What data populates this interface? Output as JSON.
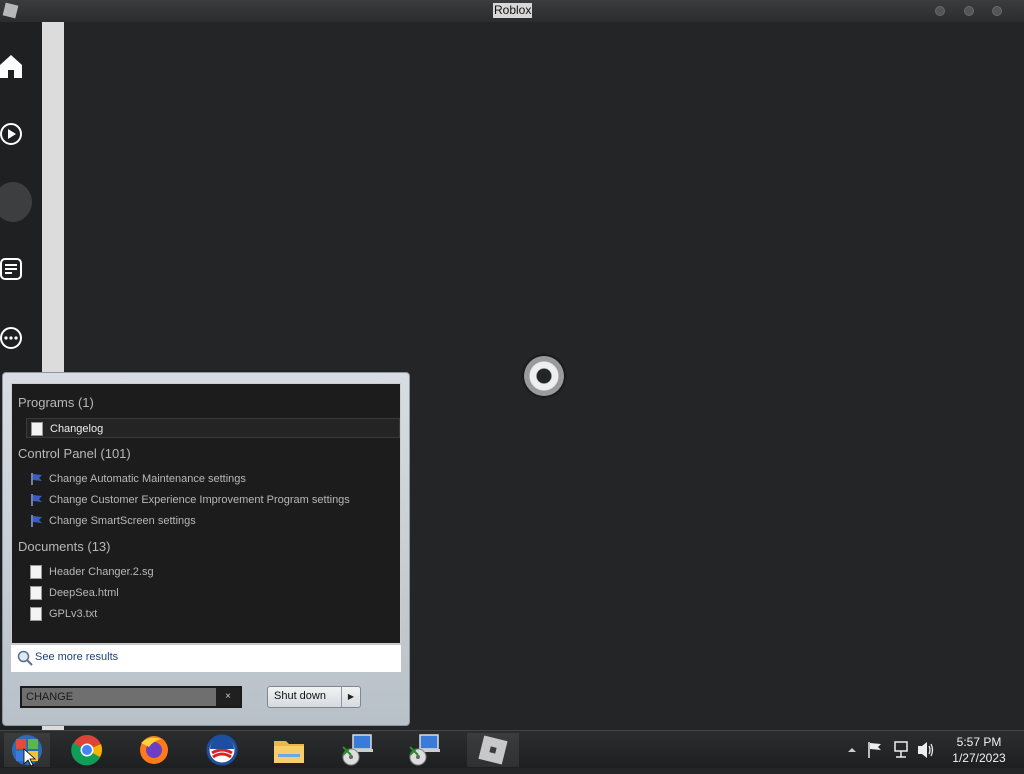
{
  "window": {
    "title": "Roblox"
  },
  "rail": {
    "icons": [
      "home-icon",
      "play-icon",
      "avatar",
      "chat-icon",
      "more-icon"
    ]
  },
  "start_menu": {
    "groups": {
      "programs": {
        "label": "Programs (1)",
        "items": [
          "Changelog"
        ]
      },
      "control_panel": {
        "label": "Control Panel (101)",
        "items": [
          "Change Automatic Maintenance settings",
          "Change Customer Experience Improvement Program settings",
          "Change SmartScreen settings"
        ]
      },
      "documents": {
        "label": "Documents (13)",
        "items": [
          "Header Changer.2.sg",
          "DeepSea.html",
          "GPLv3.txt"
        ]
      }
    },
    "see_more": "See more results",
    "search": {
      "value": "CHANGE",
      "clear": "×"
    },
    "shutdown": {
      "label": "Shut down",
      "arrow": "▶"
    }
  },
  "taskbar": {
    "apps": [
      "start-orb",
      "chrome",
      "firefox",
      "obama-logo",
      "file-explorer",
      "installer",
      "installer",
      "roblox"
    ],
    "clock": {
      "time": "5:57 PM",
      "date": "1/27/2023"
    }
  },
  "colors": {
    "background": "#232527",
    "rail": "#1f2022",
    "accent": "#1b3f7a"
  }
}
